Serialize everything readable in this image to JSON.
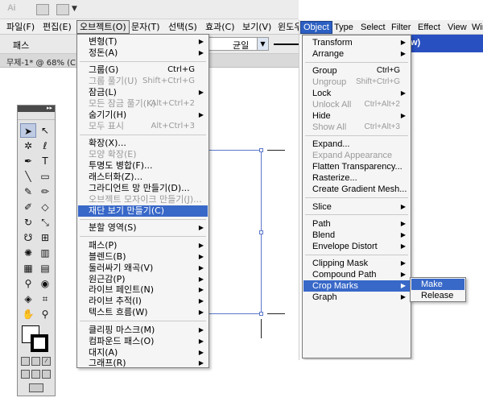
{
  "left": {
    "app_logo": "Ai",
    "menubar": [
      "파일(F)",
      "편집(E)",
      "오브젝트(O)",
      "문자(T)",
      "선택(S)",
      "효과(C)",
      "보기(V)",
      "윈도우"
    ],
    "control_bar": {
      "label": "패스",
      "uniform": "균일"
    },
    "document_tab": "무제-1* @ 68% (C",
    "object_menu": [
      {
        "label": "변형(T)",
        "submenu": true
      },
      {
        "label": "정돈(A)",
        "submenu": true
      },
      {
        "sep": true
      },
      {
        "label": "그룹(G)",
        "shortcut": "Ctrl+G"
      },
      {
        "label": "그룹 풀기(U)",
        "shortcut": "Shift+Ctrl+G",
        "disabled": true
      },
      {
        "label": "잠금(L)",
        "submenu": true
      },
      {
        "label": "모든 잠금 풀기(K)",
        "shortcut": "Alt+Ctrl+2",
        "disabled": true
      },
      {
        "label": "숨기기(H)",
        "submenu": true
      },
      {
        "label": "모두 표시",
        "shortcut": "Alt+Ctrl+3",
        "disabled": true
      },
      {
        "sep": true
      },
      {
        "label": "확장(X)..."
      },
      {
        "label": "모양 확장(E)",
        "disabled": true
      },
      {
        "label": "투명도 병합(F)..."
      },
      {
        "label": "래스터화(Z)..."
      },
      {
        "label": "그라디언트 망 만들기(D)..."
      },
      {
        "label": "오브젝트 모자이크 만들기(J)...",
        "disabled": true
      },
      {
        "label": "재단 보기 만들기(C)",
        "highlighted": true
      },
      {
        "sep": true
      },
      {
        "label": "분할 영역(S)",
        "submenu": true
      },
      {
        "sep": true
      },
      {
        "label": "패스(P)",
        "submenu": true
      },
      {
        "label": "블렌드(B)",
        "submenu": true
      },
      {
        "label": "둘러싸기 왜곡(V)",
        "submenu": true
      },
      {
        "label": "원근감(P)",
        "submenu": true
      },
      {
        "label": "라이브 페인트(N)",
        "submenu": true
      },
      {
        "label": "라이브 추적(I)",
        "submenu": true
      },
      {
        "label": "텍스트 흐름(W)",
        "submenu": true
      },
      {
        "sep": true
      },
      {
        "label": "클리핑 마스크(M)",
        "submenu": true
      },
      {
        "label": "컴파운드 패스(O)",
        "submenu": true
      },
      {
        "label": "대지(A)",
        "submenu": true
      },
      {
        "label": "그래프(R)",
        "submenu": true
      }
    ]
  },
  "right": {
    "menubar": [
      "Object",
      "Type",
      "Select",
      "Filter",
      "Effect",
      "View",
      "Win"
    ],
    "title_fragment": "w)",
    "object_menu": [
      {
        "label": "Transform",
        "submenu": true
      },
      {
        "label": "Arrange",
        "submenu": true
      },
      {
        "sep": true
      },
      {
        "label": "Group",
        "shortcut": "Ctrl+G"
      },
      {
        "label": "Ungroup",
        "shortcut": "Shift+Ctrl+G",
        "disabled": true
      },
      {
        "label": "Lock",
        "submenu": true
      },
      {
        "label": "Unlock All",
        "shortcut": "Ctrl+Alt+2",
        "disabled": true
      },
      {
        "label": "Hide",
        "submenu": true
      },
      {
        "label": "Show All",
        "shortcut": "Ctrl+Alt+3",
        "disabled": true
      },
      {
        "sep": true
      },
      {
        "label": "Expand..."
      },
      {
        "label": "Expand Appearance",
        "disabled": true
      },
      {
        "label": "Flatten Transparency..."
      },
      {
        "label": "Rasterize..."
      },
      {
        "label": "Create Gradient Mesh..."
      },
      {
        "sep": true
      },
      {
        "label": "Slice",
        "submenu": true
      },
      {
        "sep": true
      },
      {
        "label": "Path",
        "submenu": true
      },
      {
        "label": "Blend",
        "submenu": true
      },
      {
        "label": "Envelope Distort",
        "submenu": true
      },
      {
        "sep": true
      },
      {
        "label": "Clipping Mask",
        "submenu": true
      },
      {
        "label": "Compound Path",
        "submenu": true
      },
      {
        "label": "Crop Marks",
        "submenu": true,
        "highlighted": true
      },
      {
        "label": "Graph",
        "submenu": true
      }
    ],
    "crop_marks_submenu": [
      {
        "label": "Make",
        "highlighted": true
      },
      {
        "label": "Release"
      }
    ]
  },
  "colors": {
    "highlight": "#3868c8",
    "menubar_active": "#2c5fc2",
    "artboard_edge": "#5b78c9"
  }
}
